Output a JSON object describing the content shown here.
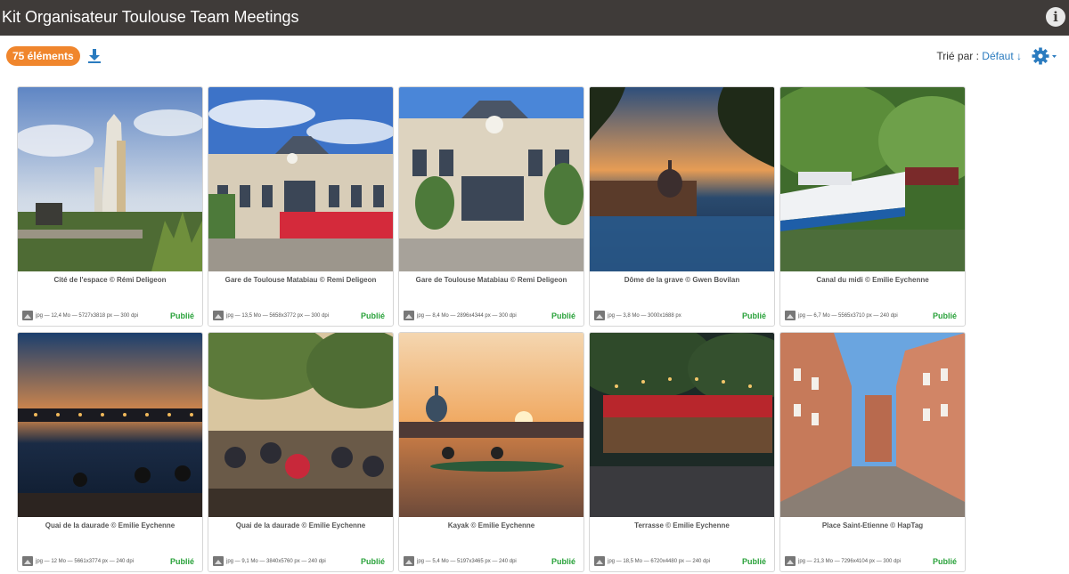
{
  "header": {
    "title": "Kit Organisateur Toulouse Team Meetings",
    "info_icon": "info-icon",
    "info_glyph": "i"
  },
  "toolbar": {
    "count_label": "75 éléments",
    "download_icon": "download-icon",
    "sort_label": "Trié par :",
    "sort_value": "Défaut ↓",
    "settings_icon": "gear-icon"
  },
  "colors": {
    "accent": "#f0862d",
    "published": "#2aa23b",
    "link": "#2a7bbf",
    "topbar": "#3f3b39"
  },
  "cards": [
    {
      "caption": "Cité de l'espace © Rémi Deligeon",
      "meta": "jpg — 12,4 Mo — 5727x3818 px — 300 dpi",
      "status": "Publié"
    },
    {
      "caption": "Gare de Toulouse Matabiau © Remi Deligeon",
      "meta": "jpg — 13,5 Mo — 5658x3772 px — 300 dpi",
      "status": "Publié"
    },
    {
      "caption": "Gare de Toulouse Matabiau © Remi Deligeon",
      "meta": "jpg — 8,4 Mo — 2896x4344 px — 300 dpi",
      "status": "Publié"
    },
    {
      "caption": "Dôme de la grave © Gwen Bovilan",
      "meta": "jpg — 3,8 Mo — 3000x1688 px",
      "status": "Publié"
    },
    {
      "caption": "Canal du midi © Emilie Eychenne",
      "meta": "jpg — 6,7 Mo — 5565x3710 px — 240 dpi",
      "status": "Publié"
    },
    {
      "caption": "Quai de la daurade © Emilie Eychenne",
      "meta": "jpg — 12 Mo — 5661x3774 px — 240 dpi",
      "status": "Publié"
    },
    {
      "caption": "Quai de la daurade © Emilie Eychenne",
      "meta": "jpg — 9,1 Mo — 3840x5760 px — 240 dpi",
      "status": "Publié"
    },
    {
      "caption": "Kayak © Emilie Eychenne",
      "meta": "jpg — 5,4 Mo — 5197x3465 px — 240 dpi",
      "status": "Publié"
    },
    {
      "caption": "Terrasse © Emilie Eychenne",
      "meta": "jpg — 18,5 Mo — 6720x4480 px — 240 dpi",
      "status": "Publié"
    },
    {
      "caption": "Place Saint-Etienne © HapTag",
      "meta": "jpg — 21,3 Mo — 7296x4104 px — 300 dpi",
      "status": "Publié"
    }
  ]
}
